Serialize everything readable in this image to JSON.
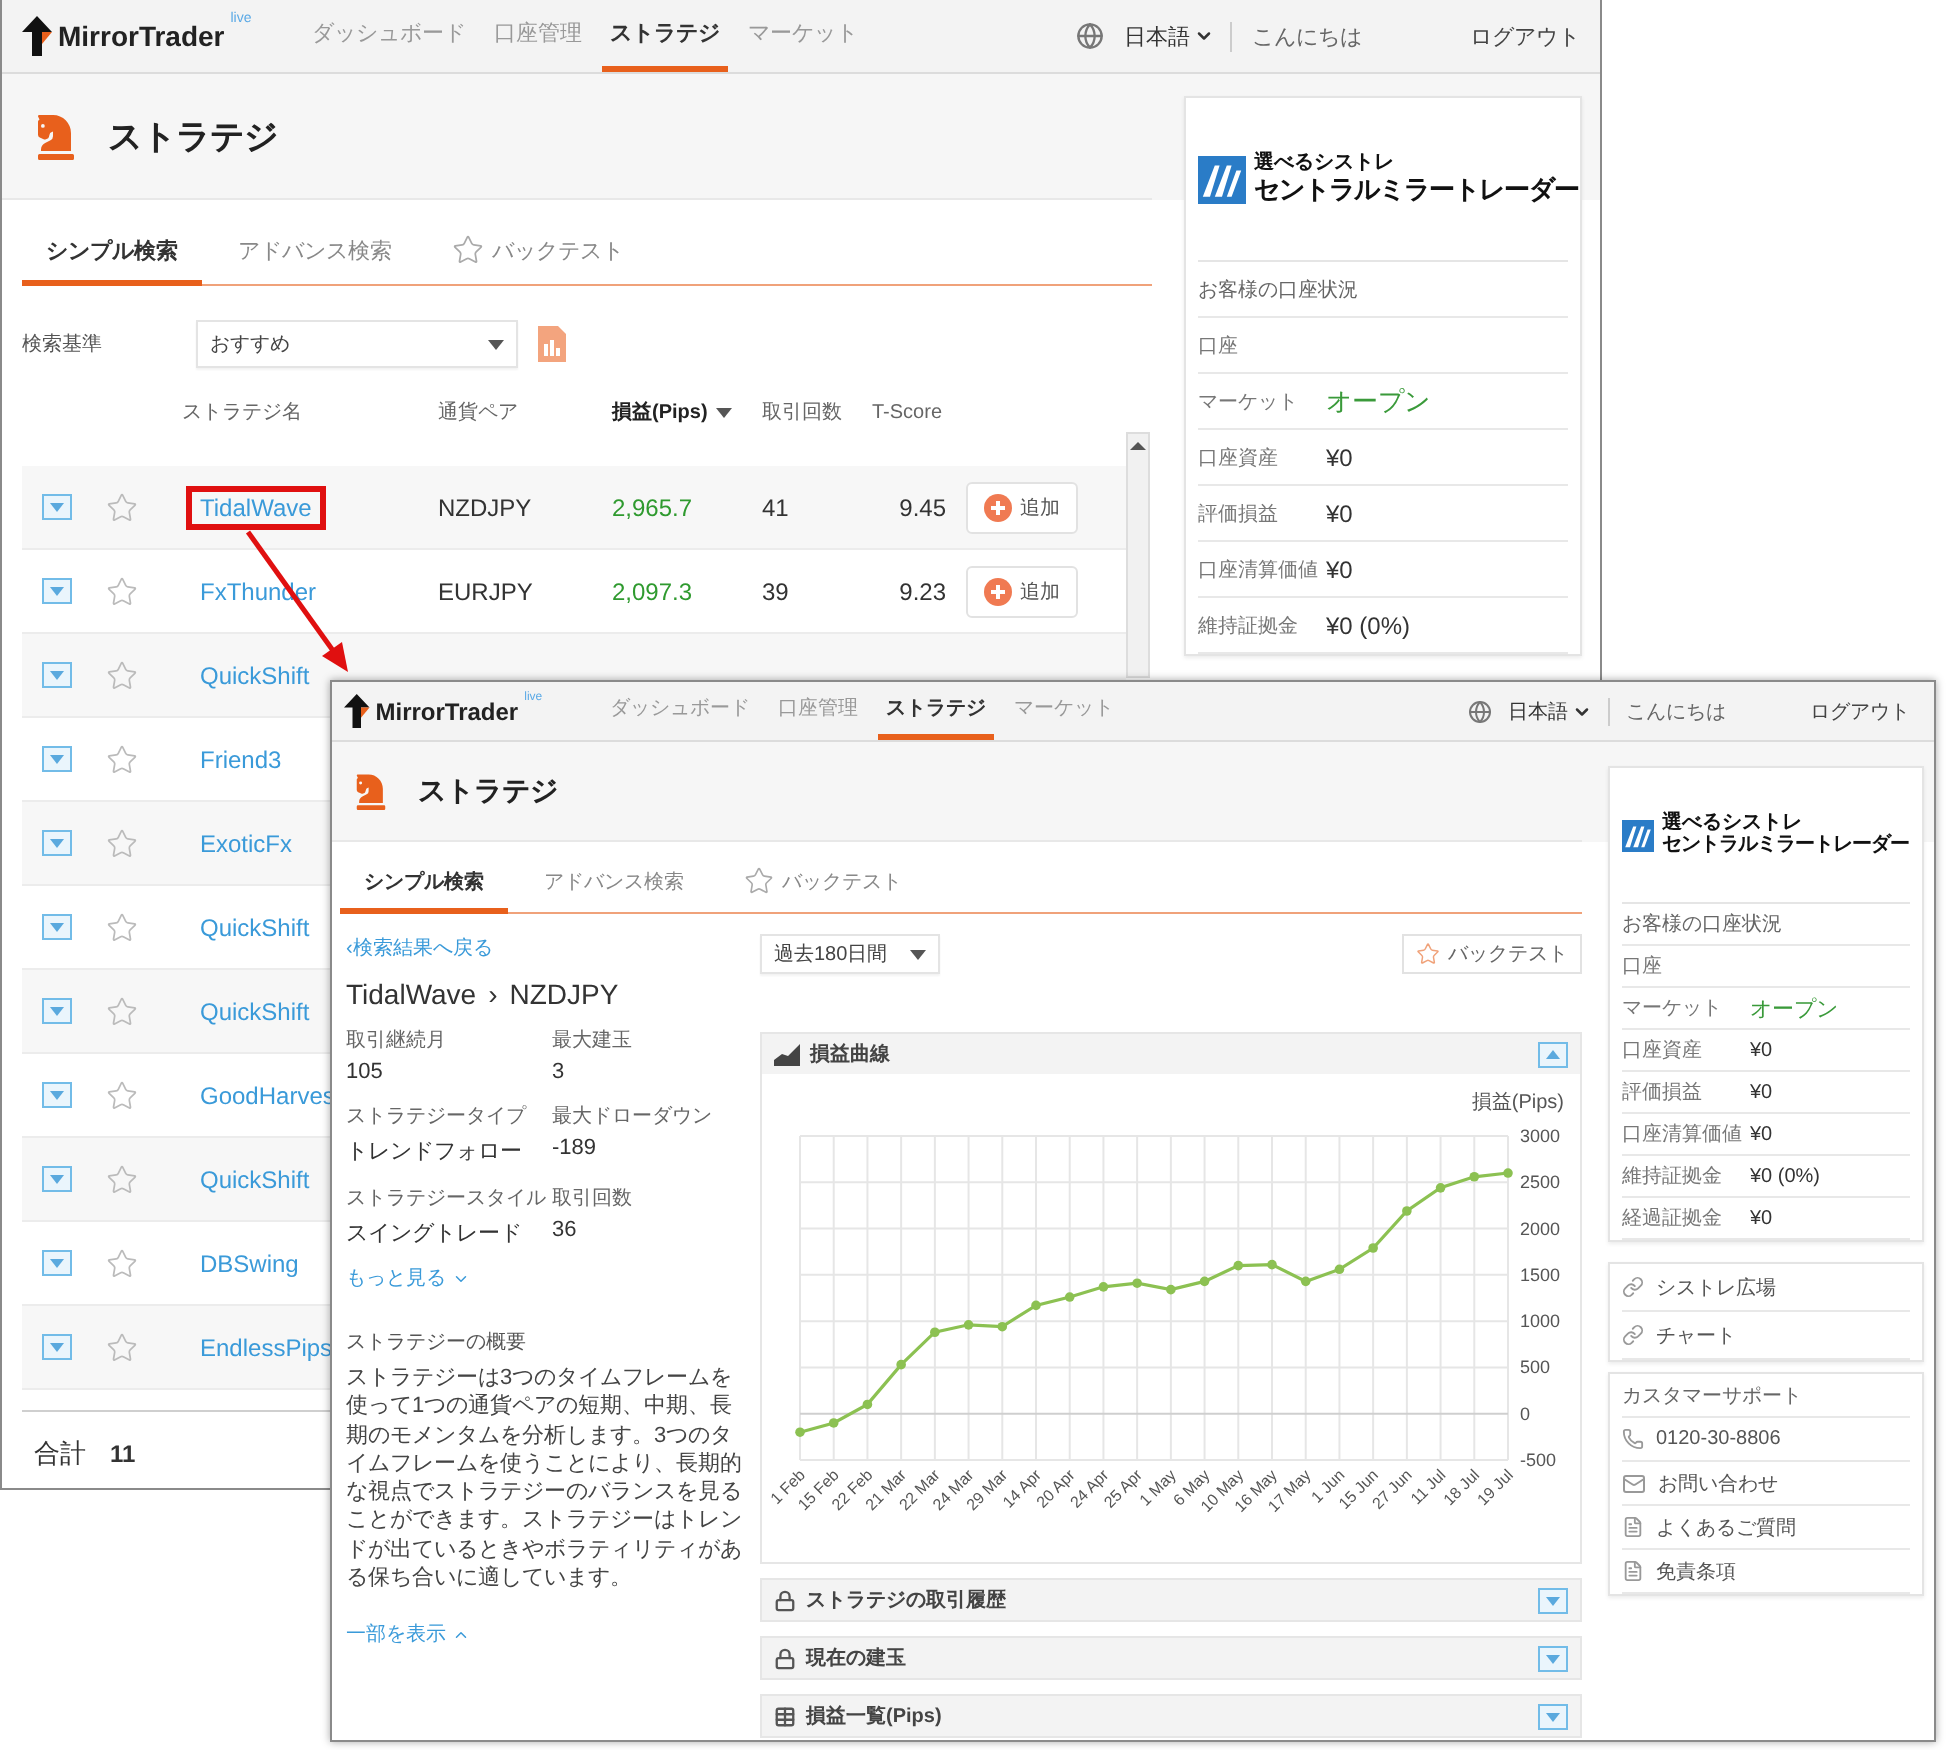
{
  "back_window": {
    "nav": {
      "brand": "MirrorTrader",
      "badge": "live",
      "items": [
        {
          "label": "ダッシュボード",
          "selected": false
        },
        {
          "label": "口座管理",
          "selected": false
        },
        {
          "label": "ストラテジ",
          "selected": true
        },
        {
          "label": "マーケット",
          "selected": false
        }
      ],
      "language": "日本語",
      "greeting": "こんにちは",
      "logout": "ログアウト"
    },
    "page_title": "ストラテジ",
    "tabs": [
      {
        "label": "シンプル検索",
        "selected": true,
        "kind": "text"
      },
      {
        "label": "アドバンス検索",
        "selected": false,
        "kind": "text"
      },
      {
        "label": "バックテスト",
        "selected": false,
        "kind": "star"
      }
    ],
    "search": {
      "label": "検索基準",
      "value": "おすすめ"
    },
    "columns": [
      {
        "label": "ストラテジ名",
        "sorted": false
      },
      {
        "label": "通貨ペア",
        "sorted": false
      },
      {
        "label": "損益(Pips)",
        "sorted": true
      },
      {
        "label": "取引回数",
        "sorted": false
      },
      {
        "label": "T-Score",
        "sorted": false
      }
    ],
    "rows": [
      {
        "name": "TidalWave",
        "highlighted": true,
        "pair": "NZDJPY",
        "pips": "2,965.7",
        "trades": "41",
        "tscore": "9.45",
        "action": "追加"
      },
      {
        "name": "FxThunder",
        "highlighted": false,
        "pair": "EURJPY",
        "pips": "2,097.3",
        "trades": "39",
        "tscore": "9.23",
        "action": "追加"
      },
      {
        "name": "QuickShift",
        "highlighted": false
      },
      {
        "name": "Friend3",
        "highlighted": false
      },
      {
        "name": "ExoticFx",
        "highlighted": false
      },
      {
        "name": "QuickShift",
        "highlighted": false
      },
      {
        "name": "QuickShift",
        "highlighted": false
      },
      {
        "name": "GoodHarves",
        "highlighted": false
      },
      {
        "name": "QuickShift",
        "highlighted": false
      },
      {
        "name": "DBSwing",
        "highlighted": false
      },
      {
        "name": "EndlessPips",
        "highlighted": false
      }
    ],
    "total": {
      "label": "合計",
      "value": "11"
    },
    "sidebar": {
      "logo_tagline": "選べるシストレ",
      "logo_name": "セントラルミラートレーダー",
      "heading": "お客様の口座状況",
      "rows": [
        {
          "label": "口座"
        },
        {
          "label": "マーケット",
          "value": "オープン",
          "kind": "status"
        },
        {
          "label": "口座資産",
          "value": "¥0",
          "kind": "amount"
        },
        {
          "label": "評価損益",
          "value": "¥0",
          "kind": "amount"
        },
        {
          "label": "口座清算価値",
          "value": "¥0",
          "kind": "amount"
        },
        {
          "label": "維持証拠金",
          "value": "¥0 (0%)",
          "kind": "amount"
        }
      ]
    }
  },
  "front_window": {
    "nav": {
      "brand": "MirrorTrader",
      "badge": "live",
      "items": [
        {
          "label": "ダッシュボード",
          "selected": false
        },
        {
          "label": "口座管理",
          "selected": false
        },
        {
          "label": "ストラテジ",
          "selected": true
        },
        {
          "label": "マーケット",
          "selected": false
        }
      ],
      "language": "日本語",
      "greeting": "こんにちは",
      "logout": "ログアウト"
    },
    "page_title": "ストラテジ",
    "tabs": [
      {
        "label": "シンプル検索",
        "selected": true,
        "kind": "text"
      },
      {
        "label": "アドバンス検索",
        "selected": false,
        "kind": "text"
      },
      {
        "label": "バックテスト",
        "selected": false,
        "kind": "star"
      }
    ],
    "back_link": "‹検索結果へ戻る",
    "title": {
      "strategy": "TidalWave",
      "separator": "›",
      "pair": "NZDJPY"
    },
    "stats": [
      {
        "label": "取引継続月",
        "value": "105"
      },
      {
        "label": "最大建玉",
        "value": "3"
      },
      {
        "label": "ストラテジータイプ",
        "value": "トレンドフォロー"
      },
      {
        "label": "最大ドローダウン",
        "value": "-189"
      },
      {
        "label": "ストラテジースタイル",
        "value": "スイングトレード"
      },
      {
        "label": "取引回数",
        "value": "36"
      }
    ],
    "more_link": "もっと見る",
    "summary_heading": "ストラテジーの概要",
    "summary": "ストラテジーは3つのタイムフレームを使って1つの通貨ペアの短期、中期、長期のモメンタムを分析します。3つのタイムフレームを使うことにより、長期的な視点でストラテジーのバランスを見ることができます。ストラテジーはトレンドが出ているときやボラティリティがある保ち合いに適しています。",
    "less_link": "一部を表示",
    "period": "過去180日間",
    "backtest_button": "バックテスト",
    "chart_panel": {
      "title": "損益曲線",
      "expanded": true,
      "chart_data": {
        "type": "line",
        "grid": true,
        "categories": [
          "1 Feb",
          "15 Feb",
          "22 Feb",
          "21 Mar",
          "22 Mar",
          "24 Mar",
          "29 Mar",
          "14 Apr",
          "20 Apr",
          "24 Apr",
          "25 Apr",
          "1 May",
          "6 May",
          "10 May",
          "16 May",
          "17 May",
          "1 Jun",
          "15 Jun",
          "27 Jun",
          "11 Jul",
          "18 Jul",
          "19 Jul"
        ],
        "series": [
          {
            "name": "損益(Pips)",
            "color": "#8cc152",
            "marker": true,
            "values": [
              -200,
              -100,
              100,
              530,
              880,
              960,
              940,
              1170,
              1260,
              1370,
              1410,
              1340,
              1430,
              1600,
              1610,
              1430,
              1560,
              1790,
              2190,
              2440,
              2560,
              2600
            ]
          }
        ],
        "ylim": [
          -500,
          3000
        ],
        "yticks": [
          -500,
          0,
          500,
          1000,
          1500,
          2000,
          2500,
          3000
        ]
      }
    },
    "panels": [
      {
        "title": "ストラテジの取引履歴",
        "kind": "lock",
        "expanded": false
      },
      {
        "title": "現在の建玉",
        "kind": "lock",
        "expanded": false
      },
      {
        "title": "損益一覧(Pips)",
        "kind": "table",
        "expanded": false
      }
    ],
    "sidebar": {
      "logo_tagline": "選べるシストレ",
      "logo_name": "セントラルミラートレーダー",
      "heading": "お客様の口座状況",
      "rows": [
        {
          "label": "口座"
        },
        {
          "label": "マーケット",
          "value": "オープン",
          "kind": "status"
        },
        {
          "label": "口座資産",
          "value": "¥0",
          "kind": "amount"
        },
        {
          "label": "評価損益",
          "value": "¥0",
          "kind": "amount"
        },
        {
          "label": "口座清算価値",
          "value": "¥0",
          "kind": "amount"
        },
        {
          "label": "維持証拠金",
          "value": "¥0 (0%)",
          "kind": "amount"
        },
        {
          "label": "経過証拠金",
          "value": "¥0",
          "kind": "amount"
        }
      ]
    },
    "links": [
      {
        "label": "シストレ広場"
      },
      {
        "label": "チャート"
      }
    ],
    "support": {
      "heading": "カスタマーサポート",
      "items": [
        {
          "label": "0120-30-8806",
          "kind": "phone"
        },
        {
          "label": "お問い合わせ",
          "kind": "mail"
        },
        {
          "label": "よくあるご質問",
          "kind": "document"
        },
        {
          "label": "免責条項",
          "kind": "document"
        }
      ]
    }
  }
}
